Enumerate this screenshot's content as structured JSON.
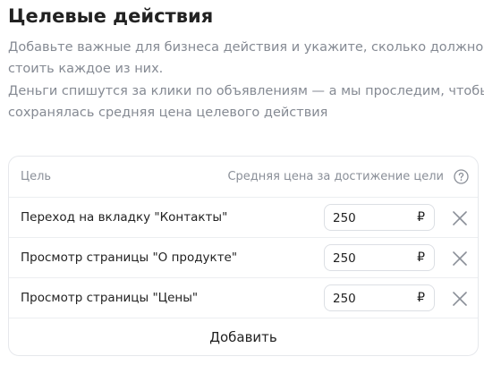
{
  "header": {
    "title": "Целевые действия",
    "description_lines": [
      "Добавьте важные для бизнеса действия и укажите, сколько должно",
      "стоить каждое из них.",
      "Деньги спишутся за клики по объявлениям — а мы проследим, чтобы",
      "сохранялась средняя цена целевого действия"
    ]
  },
  "table": {
    "column_goal": "Цель",
    "column_price": "Средняя цена за достижение цели",
    "help_icon": "question-circle-icon",
    "remove_icon": "close-x-icon",
    "rows": [
      {
        "label": "Переход на вкладку \"Контакты\"",
        "price": "250",
        "currency": "₽"
      },
      {
        "label": "Просмотр страницы \"О продукте\"",
        "price": "250",
        "currency": "₽"
      },
      {
        "label": "Просмотр страницы \"Цены\"",
        "price": "250",
        "currency": "₽"
      }
    ],
    "add_label": "Добавить"
  },
  "colors": {
    "title": "#222222",
    "description": "#858a93",
    "border": "#e6e8ec",
    "muted": "#8a8f98"
  }
}
